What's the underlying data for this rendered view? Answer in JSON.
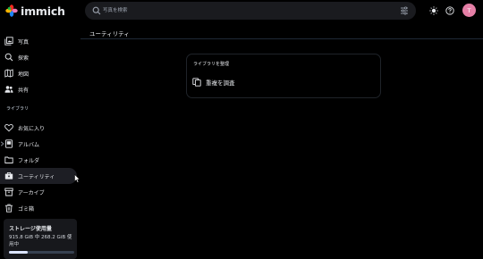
{
  "app": {
    "name": "immich"
  },
  "search": {
    "placeholder": "写真を検索"
  },
  "user": {
    "initial": "T",
    "avatar_color": "#e57fa6"
  },
  "sidebar": {
    "items": [
      {
        "label": "写真",
        "icon": "photos-icon"
      },
      {
        "label": "探索",
        "icon": "explore-icon"
      },
      {
        "label": "地図",
        "icon": "map-icon"
      },
      {
        "label": "共有",
        "icon": "sharing-icon"
      }
    ],
    "library_label": "ライブラリ",
    "library_items": [
      {
        "label": "お気に入り",
        "icon": "heart-icon"
      },
      {
        "label": "アルバム",
        "icon": "album-icon"
      },
      {
        "label": "フォルダ",
        "icon": "folder-icon"
      },
      {
        "label": "ユーティリティ",
        "icon": "toolbox-icon",
        "active": true
      },
      {
        "label": "アーカイブ",
        "icon": "archive-icon"
      },
      {
        "label": "ゴミ箱",
        "icon": "trash-icon"
      }
    ]
  },
  "storage": {
    "title": "ストレージ使用量",
    "usage": "915.8 GiB 中 268.2 GiB 使用中",
    "used_fraction": 0.293
  },
  "main": {
    "title": "ユーティリティ",
    "card_title": "ライブラリを整理",
    "card_item": "重複を調査"
  }
}
